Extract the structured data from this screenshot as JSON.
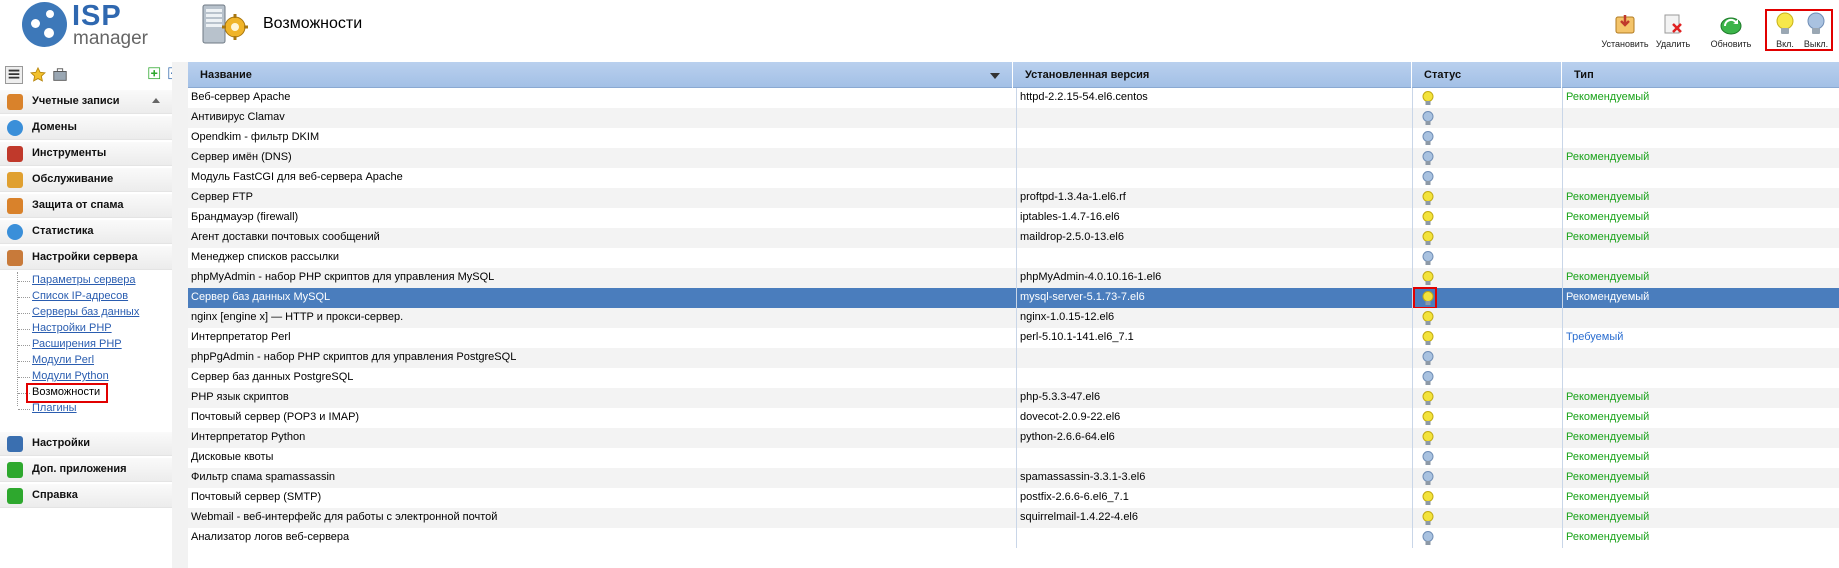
{
  "app": {
    "logo_isp": "ISP",
    "logo_manager": "manager"
  },
  "header": {
    "title": "Возможности"
  },
  "toolbar": {
    "buttons": [
      {
        "label": "Установить",
        "icon": "install-icon"
      },
      {
        "label": "Удалить",
        "icon": "delete-icon"
      },
      {
        "label": "Обновить",
        "icon": "refresh-icon"
      },
      {
        "label": "Вкл.",
        "icon": "bulb-on-icon"
      },
      {
        "label": "Выкл.",
        "icon": "bulb-off-icon"
      }
    ]
  },
  "sidebar": {
    "groups": [
      {
        "label": "Учетные записи",
        "icon": "user-accounts-icon",
        "color": "#d9822b"
      },
      {
        "label": "Домены",
        "icon": "globe-icon",
        "color": "#3a8fd9"
      },
      {
        "label": "Инструменты",
        "icon": "tools-icon",
        "color": "#c0392b"
      },
      {
        "label": "Обслуживание",
        "icon": "maintenance-icon",
        "color": "#e0a030"
      },
      {
        "label": "Защита от спама",
        "icon": "shield-icon",
        "color": "#d9822b"
      },
      {
        "label": "Статистика",
        "icon": "statistics-icon",
        "color": "#3a8fd9"
      },
      {
        "label": "Настройки сервера",
        "icon": "server-settings-icon",
        "color": "#c87a3a"
      }
    ],
    "sub_items": [
      "Параметры сервера",
      "Список IP-адресов",
      "Серверы баз данных",
      "Настройки PHP",
      "Расширения PHP",
      "Модули Perl",
      "Модули Python",
      "Возможности",
      "Плагины"
    ],
    "current_sub": "Возможности",
    "bottom_groups": [
      {
        "label": "Настройки",
        "icon": "settings-icon",
        "color": "#3a6fb0"
      },
      {
        "label": "Доп. приложения",
        "icon": "plus-icon",
        "color": "#2ea82e"
      },
      {
        "label": "Справка",
        "icon": "help-icon",
        "color": "#2ea82e"
      }
    ]
  },
  "table": {
    "columns": [
      "Название",
      "Установленная версия",
      "Статус",
      "Тип"
    ],
    "rows": [
      {
        "name": "Веб-сервер Apache",
        "version": "httpd-2.2.15-54.el6.centos",
        "status": "on",
        "type": "Рекомендуемый"
      },
      {
        "name": "Антивирус Clamav",
        "version": "",
        "status": "off",
        "type": ""
      },
      {
        "name": "Opendkim - фильтр DKIM",
        "version": "",
        "status": "off",
        "type": ""
      },
      {
        "name": "Сервер имён (DNS)",
        "version": "",
        "status": "off",
        "type": "Рекомендуемый"
      },
      {
        "name": "Модуль FastCGI для веб-сервера Apache",
        "version": "",
        "status": "off",
        "type": ""
      },
      {
        "name": "Сервер FTP",
        "version": "proftpd-1.3.4a-1.el6.rf",
        "status": "on",
        "type": "Рекомендуемый"
      },
      {
        "name": "Брандмауэр (firewall)",
        "version": "iptables-1.4.7-16.el6",
        "status": "on",
        "type": "Рекомендуемый"
      },
      {
        "name": "Агент доставки почтовых сообщений",
        "version": "maildrop-2.5.0-13.el6",
        "status": "on",
        "type": "Рекомендуемый"
      },
      {
        "name": "Менеджер списков рассылки",
        "version": "",
        "status": "off",
        "type": ""
      },
      {
        "name": "phpMyAdmin - набор PHP скриптов для управления MySQL",
        "version": "phpMyAdmin-4.0.10.16-1.el6",
        "status": "on",
        "type": "Рекомендуемый"
      },
      {
        "name": "Сервер баз данных MySQL",
        "version": "mysql-server-5.1.73-7.el6",
        "status": "on",
        "type": "Рекомендуемый",
        "selected": true
      },
      {
        "name": "nginx [engine x] — HTTP и прокси-сервер.",
        "version": "nginx-1.0.15-12.el6",
        "status": "on",
        "type": ""
      },
      {
        "name": "Интерпретатор Perl",
        "version": "perl-5.10.1-141.el6_7.1",
        "status": "on",
        "type": "Требуемый"
      },
      {
        "name": "phpPgAdmin - набор PHP скриптов для управления PostgreSQL",
        "version": "",
        "status": "off",
        "type": ""
      },
      {
        "name": "Сервер баз данных PostgreSQL",
        "version": "",
        "status": "off",
        "type": ""
      },
      {
        "name": "PHP язык скриптов",
        "version": "php-5.3.3-47.el6",
        "status": "on",
        "type": "Рекомендуемый"
      },
      {
        "name": "Почтовый сервер (POP3 и IMAP)",
        "version": "dovecot-2.0.9-22.el6",
        "status": "on",
        "type": "Рекомендуемый"
      },
      {
        "name": "Интерпретатор Python",
        "version": "python-2.6.6-64.el6",
        "status": "on",
        "type": "Рекомендуемый"
      },
      {
        "name": "Дисковые квоты",
        "version": "",
        "status": "off",
        "type": "Рекомендуемый"
      },
      {
        "name": "Фильтр спама spamassassin",
        "version": "spamassassin-3.3.1-3.el6",
        "status": "off",
        "type": "Рекомендуемый"
      },
      {
        "name": "Почтовый сервер (SMTP)",
        "version": "postfix-2.6.6-6.el6_7.1",
        "status": "on",
        "type": "Рекомендуемый"
      },
      {
        "name": "Webmail - веб-интерфейс для работы с электронной почтой",
        "version": "squirrelmail-1.4.22-4.el6",
        "status": "on",
        "type": "Рекомендуемый"
      },
      {
        "name": "Анализатор логов веб-сервера",
        "version": "",
        "status": "off",
        "type": "Рекомендуемый"
      }
    ]
  },
  "colors": {
    "header_bg": "#a9c4e8",
    "selected_row": "#4a7dbd",
    "recommended": "#1aa31a",
    "required": "#2a6dd0",
    "highlight": "#e10000"
  }
}
